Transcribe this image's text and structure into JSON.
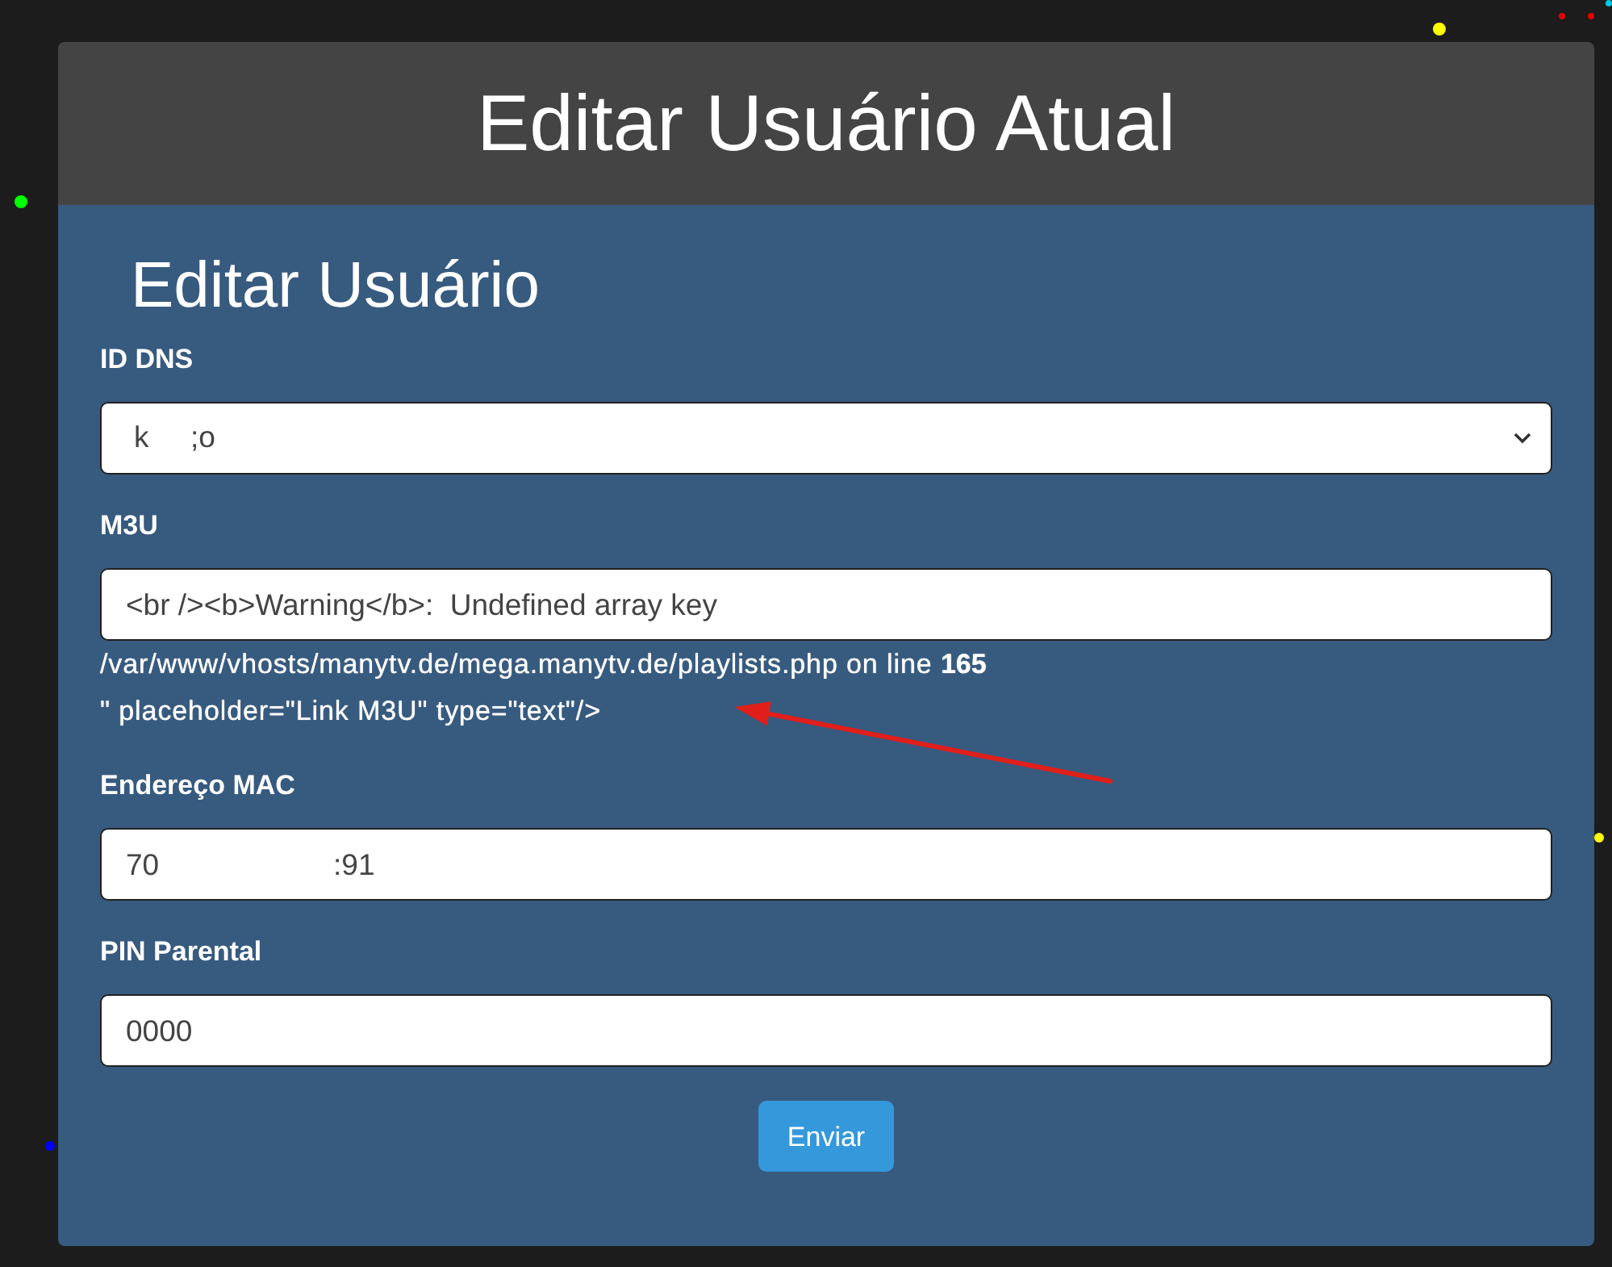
{
  "page": {
    "title": "Editar Usuário Atual"
  },
  "form": {
    "heading": "Editar Usuário",
    "fields": [
      {
        "kind": "select",
        "label": "ID DNS",
        "value": "k     ;o"
      },
      {
        "kind": "text",
        "label": "M3U",
        "value": "<br /><b>Warning</b>:  Undefined array key",
        "overflow_lines": [
          "/var/www/vhosts/manytv.de/mega.manytv.de/playlists.php on line **165**",
          "\" placeholder=\"Link M3U\" type=\"text\"/>"
        ]
      },
      {
        "kind": "text",
        "label": "Endereço MAC",
        "value": "70                     :91"
      },
      {
        "kind": "text",
        "label": "PIN Parental",
        "value": "0000"
      }
    ],
    "submit": "Enviar"
  },
  "background_dots": [
    {
      "color": "#ffff00"
    },
    {
      "color": "#e00000"
    },
    {
      "color": "#e00000"
    },
    {
      "color": "#00c8e0"
    },
    {
      "color": "#00ff00"
    },
    {
      "color": "#ffff00"
    },
    {
      "color": "#0000ff"
    }
  ]
}
